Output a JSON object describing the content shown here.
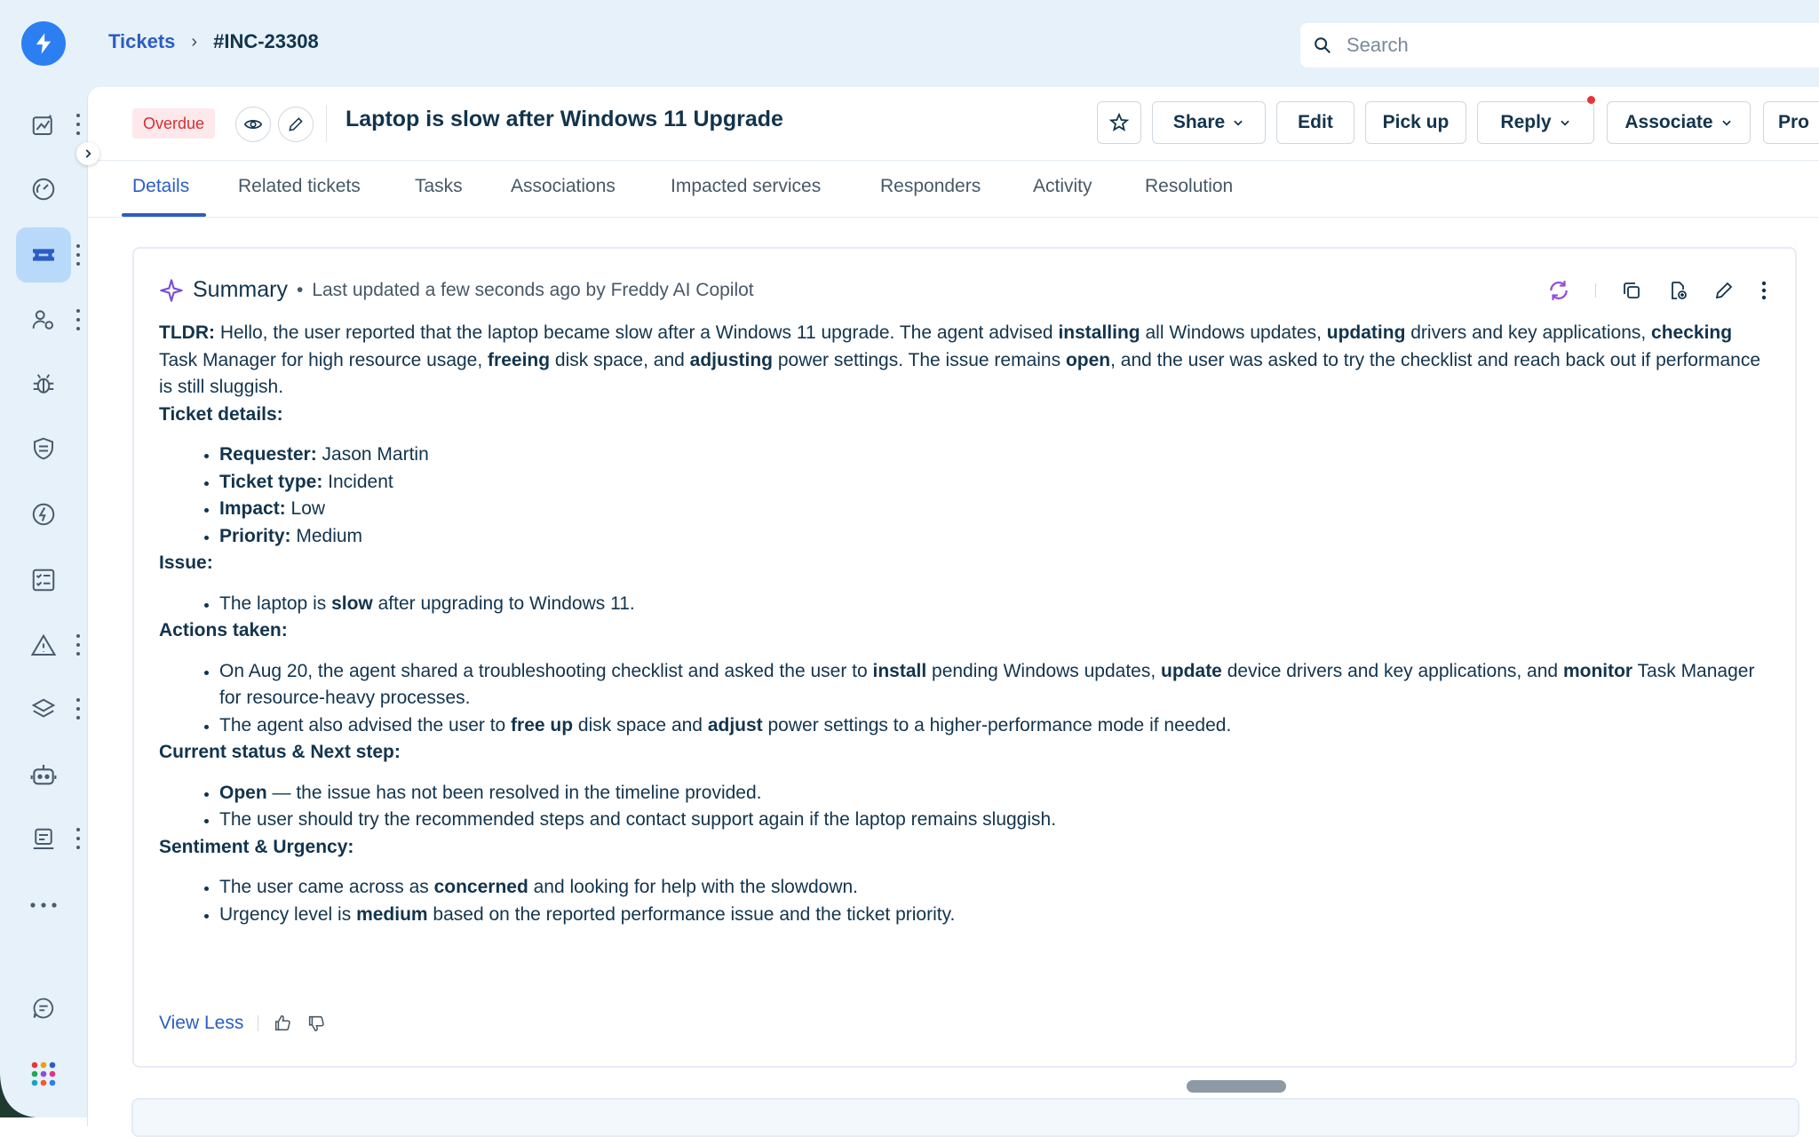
{
  "breadcrumb": {
    "link": "Tickets",
    "separator": "›",
    "current": "#INC-23308"
  },
  "search": {
    "placeholder": "Search"
  },
  "ticket": {
    "status_badge": "Overdue",
    "title": "Laptop is slow after Windows 11 Upgrade"
  },
  "actions": {
    "share": "Share",
    "edit": "Edit",
    "pickup": "Pick up",
    "reply": "Reply",
    "associate": "Associate",
    "more": "Pro"
  },
  "tabs": [
    "Details",
    "Related tickets",
    "Tasks",
    "Associations",
    "Impacted services",
    "Responders",
    "Activity",
    "Resolution"
  ],
  "summary": {
    "title": "Summary",
    "dot": "•",
    "meta": "Last updated a few seconds ago by Freddy AI Copilot",
    "tldr_label": "TLDR:",
    "tldr_parts": {
      "p1": " Hello, the user reported that the laptop became slow after a Windows 11 upgrade. The agent advised ",
      "b1": "installing",
      "p2": " all Windows updates, ",
      "b2": "updating",
      "p3": " drivers and key applications, ",
      "b3": "checking",
      "p4": " Task Manager for high resource usage, ",
      "b4": "freeing",
      "p5": " disk space, and ",
      "b5": "adjusting",
      "p6": " power settings. The issue remains ",
      "b6": "open",
      "p7": ", and the user was asked to try the checklist and reach back out if performance is still sluggish."
    },
    "ticket_details": {
      "heading": "Ticket details:",
      "requester_label": "Requester:",
      "requester": " Jason Martin",
      "type_label": "Ticket type:",
      "type": " Incident",
      "impact_label": "Impact:",
      "impact": " Low",
      "priority_label": "Priority:",
      "priority": " Medium"
    },
    "issue": {
      "heading": "Issue:",
      "p1": "The laptop is ",
      "b1": "slow",
      "p2": " after upgrading to Windows 11."
    },
    "actions_taken": {
      "heading": "Actions taken:",
      "item1": {
        "p1": "On Aug 20, the agent shared a troubleshooting checklist and asked the user to ",
        "b1": "install",
        "p2": " pending Windows updates, ",
        "b2": "update",
        "p3": " device drivers and key applications, and ",
        "b3": "monitor",
        "p4": " Task Manager for resource-heavy processes."
      },
      "item2": {
        "p1": "The agent also advised the user to ",
        "b1": "free up",
        "p2": " disk space and ",
        "b2": "adjust",
        "p3": " power settings to a higher-performance mode if needed."
      }
    },
    "status": {
      "heading": "Current status & Next step:",
      "item1": {
        "b1": "Open",
        "p1": " — the issue has not been resolved in the timeline provided."
      },
      "item2": "The user should try the recommended steps and contact support again if the laptop remains sluggish."
    },
    "sentiment": {
      "heading": "Sentiment & Urgency:",
      "item1": {
        "p1": "The user came across as ",
        "b1": "concerned",
        "p2": " and looking for help with the slowdown."
      },
      "item2": {
        "p1": "Urgency level is ",
        "b1": "medium",
        "p2": " based on the reported performance issue and the ticket priority."
      }
    },
    "view_less": "View Less"
  },
  "colors": {
    "accent": "#2c5cc5",
    "overdue_bg": "#fde9ec",
    "overdue_text": "#d72d30",
    "sidebar_bg": "#e6f1fa",
    "active_nav": "#b9d9fb"
  },
  "icons": {
    "nav": [
      "analytics-icon",
      "dashboard-gauge-icon",
      "tickets-icon",
      "users-settings-icon",
      "bug-icon",
      "shield-icon",
      "change-icon",
      "checklist-icon",
      "alert-icon",
      "layers-icon",
      "bot-icon",
      "assets-icon",
      "more-icon",
      "chat-icon",
      "apps-grid-icon"
    ]
  }
}
